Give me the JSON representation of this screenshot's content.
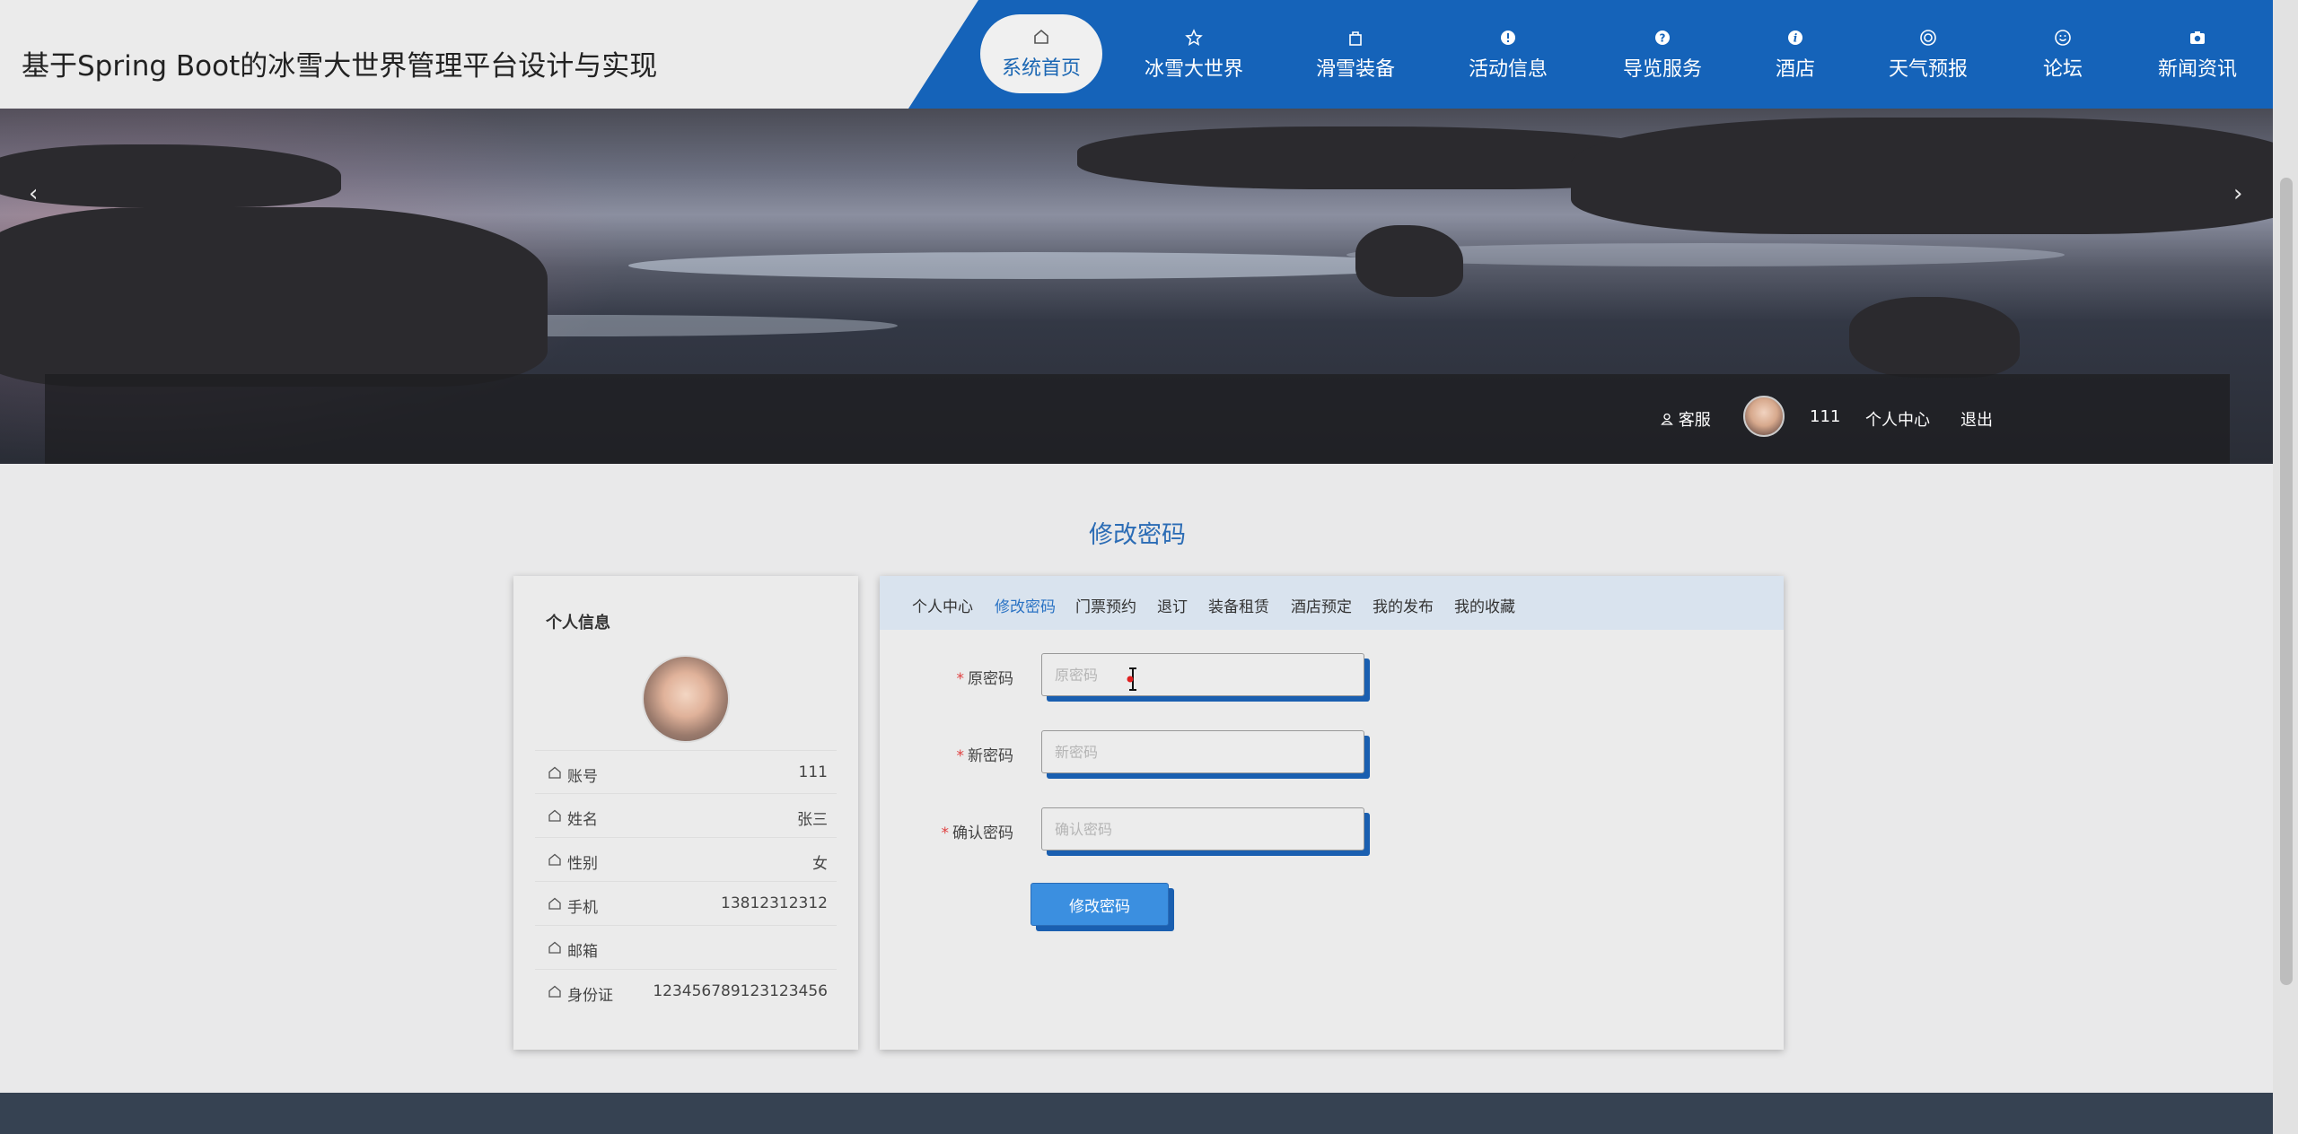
{
  "header": {
    "title": "基于Spring Boot的冰雪大世界管理平台设计与实现"
  },
  "nav": [
    {
      "label": "系统首页",
      "icon": "home-icon",
      "active": true
    },
    {
      "label": "冰雪大世界",
      "icon": "star-icon"
    },
    {
      "label": "滑雪装备",
      "icon": "bag-icon"
    },
    {
      "label": "活动信息",
      "icon": "alert-icon"
    },
    {
      "label": "导览服务",
      "icon": "question-icon"
    },
    {
      "label": "酒店",
      "icon": "info-icon"
    },
    {
      "label": "天气预报",
      "icon": "lifebuoy-icon"
    },
    {
      "label": "论坛",
      "icon": "smile-icon"
    },
    {
      "label": "新闻资讯",
      "icon": "camera-icon"
    }
  ],
  "userbar": {
    "service": "客服",
    "username": "111",
    "center": "个人中心",
    "logout": "退出"
  },
  "page": {
    "heading": "修改密码"
  },
  "profile": {
    "title": "个人信息",
    "rows": [
      {
        "label": "账号",
        "value": "111"
      },
      {
        "label": "姓名",
        "value": "张三"
      },
      {
        "label": "性别",
        "value": "女"
      },
      {
        "label": "手机",
        "value": "13812312312"
      },
      {
        "label": "邮箱",
        "value": ""
      },
      {
        "label": "身份证",
        "value": "123456789123123456"
      }
    ]
  },
  "tabs": [
    "个人中心",
    "修改密码",
    "门票预约",
    "退订",
    "装备租赁",
    "酒店预定",
    "我的发布",
    "我的收藏"
  ],
  "active_tab": "修改密码",
  "form": {
    "old_password": {
      "label": "原密码",
      "placeholder": "原密码"
    },
    "new_password": {
      "label": "新密码",
      "placeholder": "新密码"
    },
    "confirm_password": {
      "label": "确认密码",
      "placeholder": "确认密码"
    },
    "submit": "修改密码"
  },
  "colors": {
    "primary": "#1563b9",
    "accent_button": "#3b8fe0",
    "footer": "#364252",
    "required": "#e04040"
  }
}
